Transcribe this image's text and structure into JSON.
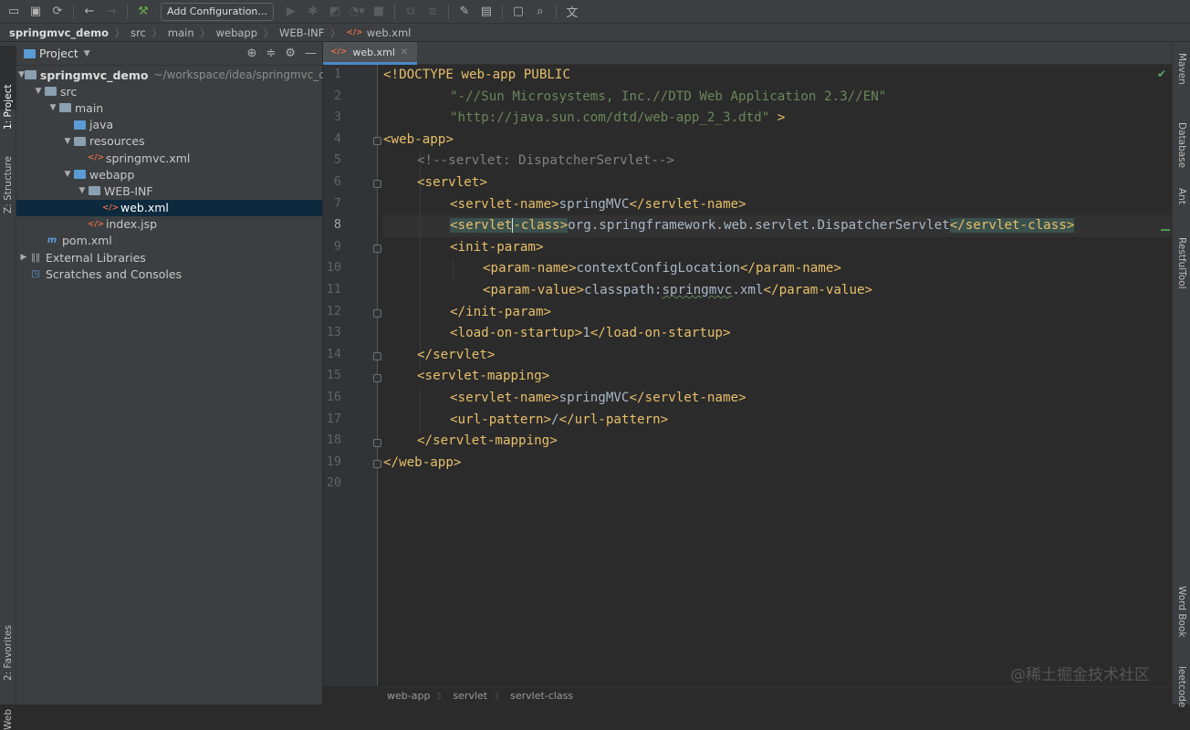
{
  "toolbar": {
    "add_configuration_label": "Add Configuration..."
  },
  "navbar": {
    "crumbs": [
      "springmvc_demo",
      "src",
      "main",
      "webapp",
      "WEB-INF",
      "web.xml"
    ]
  },
  "left_strip": {
    "project_tab": "1: Project",
    "structure_tab": "Z: Structure",
    "favorites_tab": "2: Favorites",
    "web_tab": "Web"
  },
  "right_strip": {
    "maven_tab": "Maven",
    "database_tab": "Database",
    "ant_tab": "Ant",
    "restful_tab": "RestfulTool",
    "wordbook_tab": "Word Book",
    "leetcode_tab": "leetcode"
  },
  "project": {
    "title": "Project",
    "tree": [
      {
        "label": "springmvc_demo",
        "hint": "~/workspace/idea/springmvc_dem"
      },
      {
        "label": "src"
      },
      {
        "label": "main"
      },
      {
        "label": "java"
      },
      {
        "label": "resources"
      },
      {
        "label": "springmvc.xml"
      },
      {
        "label": "webapp"
      },
      {
        "label": "WEB-INF"
      },
      {
        "label": "web.xml"
      },
      {
        "label": "index.jsp"
      },
      {
        "label": "pom.xml"
      },
      {
        "label": "External Libraries"
      },
      {
        "label": "Scratches and Consoles"
      }
    ]
  },
  "editor": {
    "tab_label": "web.xml",
    "line_numbers": [
      "1",
      "2",
      "3",
      "4",
      "5",
      "6",
      "7",
      "8",
      "9",
      "10",
      "11",
      "12",
      "13",
      "14",
      "15",
      "16",
      "17",
      "18",
      "19",
      "20"
    ],
    "current_line": "8",
    "code": {
      "l1a": "<!DOCTYPE web-app PUBLIC",
      "l2": "\"-//Sun Microsystems, Inc.//DTD Web Application 2.3//EN\"",
      "l3a": "\"http://java.sun.com/dtd/web-app_2_3.dtd\"",
      "l3b": " >",
      "l4": "<web-app>",
      "l5": "<!--servlet: DispatcherServlet-->",
      "l6": "<servlet>",
      "l7a": "<servlet-name>",
      "l7b": "springMVC",
      "l7c": "</servlet-name>",
      "l8a": "<servlet",
      "l8b": "-class>",
      "l8c": "org.springframework.web.servlet.DispatcherServlet",
      "l8d": "</servlet-class>",
      "l9": "<init-param>",
      "l10a": "<param-name>",
      "l10b": "contextConfigLocation",
      "l10c": "</param-name>",
      "l11a": "<param-value>",
      "l11b": "classpath:",
      "l11c": "springmvc",
      "l11d": ".xml",
      "l11e": "</param-value>",
      "l12": "</init-param>",
      "l13a": "<load-on-startup>",
      "l13b": "1",
      "l13c": "</load-on-startup>",
      "l14": "</servlet>",
      "l15": "<servlet-mapping>",
      "l16a": "<servlet-name>",
      "l16b": "springMVC",
      "l16c": "</servlet-name>",
      "l17a": "<url-pattern>",
      "l17b": "/",
      "l17c": "</url-pattern>",
      "l18": "</servlet-mapping>",
      "l19": "</web-app>"
    },
    "breadcrumbs": [
      "web-app",
      "servlet",
      "servlet-class"
    ]
  },
  "watermark": "@稀土掘金技术社区"
}
